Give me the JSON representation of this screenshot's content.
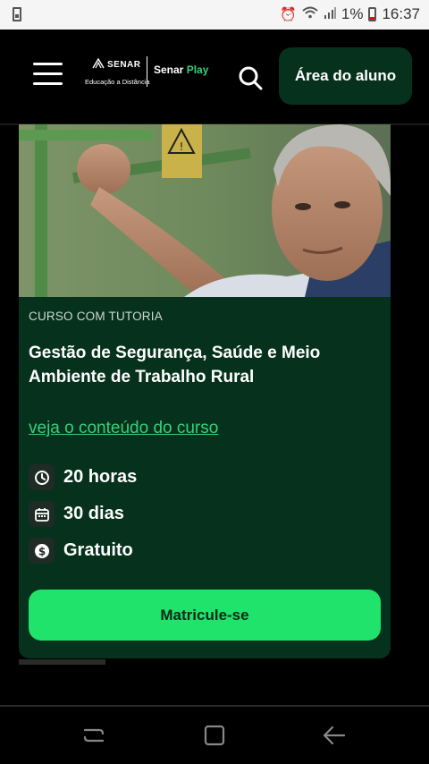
{
  "status_bar": {
    "battery_percent": "1%",
    "time": "16:37",
    "icons": [
      "alarm-icon",
      "wifi-icon",
      "signal-icon",
      "battery-icon"
    ]
  },
  "header": {
    "logo": {
      "brand": "SENAR",
      "subtitle": "Educação a Distância",
      "product_prefix": "Senar",
      "product_suffix": "Play"
    },
    "student_area_label": "Área do aluno",
    "icons": [
      "menu-icon",
      "search-icon"
    ]
  },
  "course": {
    "tag": "CURSO COM TUTORIA",
    "title": "Gestão de Segurança, Saúde e Meio Ambiente de Trabalho Rural",
    "link_label": "veja o conteúdo do curso",
    "info": [
      {
        "icon": "clock-icon",
        "text": "20 horas"
      },
      {
        "icon": "calendar-icon",
        "text": "30 dias"
      },
      {
        "icon": "dollar-icon",
        "text": "Gratuito"
      }
    ],
    "enroll_label": "Matricule-se"
  },
  "colors": {
    "background": "#000000",
    "card": "#06321d",
    "accent_green": "#1fe36b",
    "link_green": "#33d17a"
  },
  "navbar": {
    "icons": [
      "recent-apps-icon",
      "home-icon",
      "back-icon"
    ]
  }
}
